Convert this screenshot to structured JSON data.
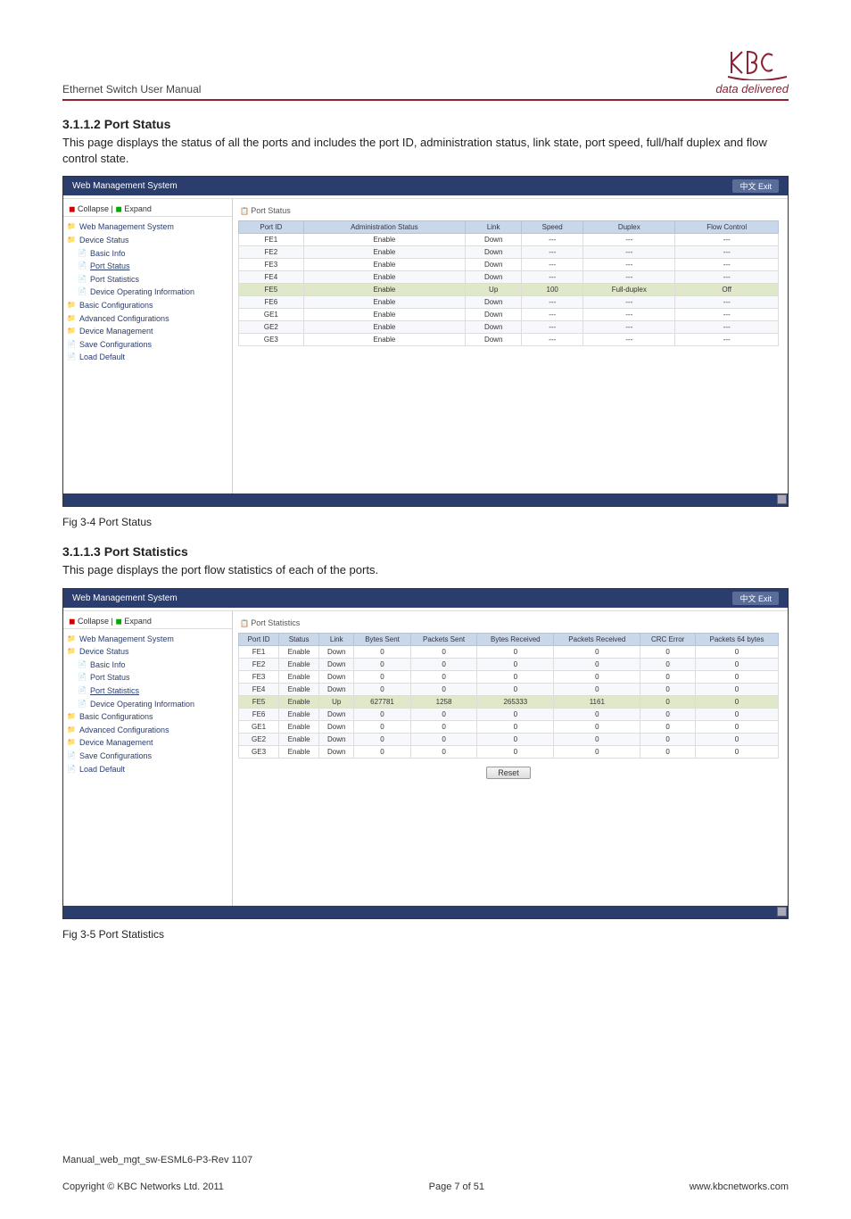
{
  "doc": {
    "header_title": "Ethernet Switch User Manual",
    "logo_tag": "data delivered",
    "footer_manual": "Manual_web_mgt_sw-ESML6-P3-Rev 1107",
    "footer_copy": "Copyright © KBC Networks Ltd. 2011",
    "footer_page": "Page 7 of 51",
    "footer_url": "www.kbcnetworks.com"
  },
  "sec1": {
    "heading": "3.1.1.2 Port Status",
    "text": "This page displays the status of all the ports and includes the port ID, administration status, link state, port speed, full/half duplex and flow control state.",
    "caption": "Fig 3-4 Port Status"
  },
  "sec2": {
    "heading": "3.1.1.3 Port Statistics",
    "text": "This page displays the port flow statistics of each of the ports.",
    "caption": "Fig 3-5 Port Statistics"
  },
  "app": {
    "title": "Web Management System",
    "exit": "中文 Exit",
    "collapse": "Collapse",
    "expand": "Expand",
    "reset": "Reset",
    "tree": {
      "root": "Web Management System",
      "device_status": "Device Status",
      "basic_info": "Basic Info",
      "port_status": "Port Status",
      "port_statistics": "Port Statistics",
      "device_op": "Device Operating Information",
      "basic_conf": "Basic Configurations",
      "adv_conf": "Advanced Configurations",
      "device_mgmt": "Device Management",
      "save_conf": "Save Configurations",
      "load_default": "Load Default"
    }
  },
  "panel1": {
    "title": "Port Status",
    "headers": [
      "Port ID",
      "Administration Status",
      "Link",
      "Speed",
      "Duplex",
      "Flow Control"
    ],
    "rows": [
      {
        "id": "FE1",
        "admin": "Enable",
        "link": "Down",
        "speed": "---",
        "duplex": "---",
        "flow": "---"
      },
      {
        "id": "FE2",
        "admin": "Enable",
        "link": "Down",
        "speed": "---",
        "duplex": "---",
        "flow": "---"
      },
      {
        "id": "FE3",
        "admin": "Enable",
        "link": "Down",
        "speed": "---",
        "duplex": "---",
        "flow": "---"
      },
      {
        "id": "FE4",
        "admin": "Enable",
        "link": "Down",
        "speed": "---",
        "duplex": "---",
        "flow": "---"
      },
      {
        "id": "FE5",
        "admin": "Enable",
        "link": "Up",
        "speed": "100",
        "duplex": "Full-duplex",
        "flow": "Off",
        "hl": true
      },
      {
        "id": "FE6",
        "admin": "Enable",
        "link": "Down",
        "speed": "---",
        "duplex": "---",
        "flow": "---"
      },
      {
        "id": "GE1",
        "admin": "Enable",
        "link": "Down",
        "speed": "---",
        "duplex": "---",
        "flow": "---"
      },
      {
        "id": "GE2",
        "admin": "Enable",
        "link": "Down",
        "speed": "---",
        "duplex": "---",
        "flow": "---"
      },
      {
        "id": "GE3",
        "admin": "Enable",
        "link": "Down",
        "speed": "---",
        "duplex": "---",
        "flow": "---"
      }
    ]
  },
  "panel2": {
    "title": "Port Statistics",
    "headers": [
      "Port ID",
      "Status",
      "Link",
      "Bytes Sent",
      "Packets Sent",
      "Bytes Received",
      "Packets Received",
      "CRC Error",
      "Packets 64 bytes"
    ],
    "rows": [
      {
        "id": "FE1",
        "status": "Enable",
        "link": "Down",
        "bsent": "0",
        "psent": "0",
        "brecv": "0",
        "precv": "0",
        "crc": "0",
        "p64": "0"
      },
      {
        "id": "FE2",
        "status": "Enable",
        "link": "Down",
        "bsent": "0",
        "psent": "0",
        "brecv": "0",
        "precv": "0",
        "crc": "0",
        "p64": "0"
      },
      {
        "id": "FE3",
        "status": "Enable",
        "link": "Down",
        "bsent": "0",
        "psent": "0",
        "brecv": "0",
        "precv": "0",
        "crc": "0",
        "p64": "0"
      },
      {
        "id": "FE4",
        "status": "Enable",
        "link": "Down",
        "bsent": "0",
        "psent": "0",
        "brecv": "0",
        "precv": "0",
        "crc": "0",
        "p64": "0"
      },
      {
        "id": "FE5",
        "status": "Enable",
        "link": "Up",
        "bsent": "627781",
        "psent": "1258",
        "brecv": "265333",
        "precv": "1161",
        "crc": "0",
        "p64": "0",
        "hl": true
      },
      {
        "id": "FE6",
        "status": "Enable",
        "link": "Down",
        "bsent": "0",
        "psent": "0",
        "brecv": "0",
        "precv": "0",
        "crc": "0",
        "p64": "0"
      },
      {
        "id": "GE1",
        "status": "Enable",
        "link": "Down",
        "bsent": "0",
        "psent": "0",
        "brecv": "0",
        "precv": "0",
        "crc": "0",
        "p64": "0"
      },
      {
        "id": "GE2",
        "status": "Enable",
        "link": "Down",
        "bsent": "0",
        "psent": "0",
        "brecv": "0",
        "precv": "0",
        "crc": "0",
        "p64": "0"
      },
      {
        "id": "GE3",
        "status": "Enable",
        "link": "Down",
        "bsent": "0",
        "psent": "0",
        "brecv": "0",
        "precv": "0",
        "crc": "0",
        "p64": "0"
      }
    ]
  }
}
